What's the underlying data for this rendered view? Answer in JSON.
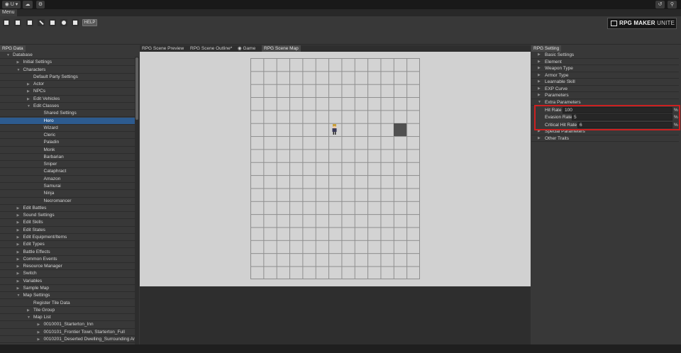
{
  "topbar": {
    "account_label": "U",
    "history_icon": "history-icon",
    "search_icon": "search-icon"
  },
  "menubar": {
    "menu_label": "Menu"
  },
  "toolbar": {
    "help_label": "HELP",
    "logo_text": "RPG MAKER",
    "logo_suffix": "UNITE"
  },
  "left_panel": {
    "tab": "RPG Data",
    "tree": [
      {
        "label": "Database",
        "indent": 0,
        "arrow": "down"
      },
      {
        "label": "Initial Settings",
        "indent": 1,
        "arrow": "right"
      },
      {
        "label": "Characters",
        "indent": 1,
        "arrow": "down"
      },
      {
        "label": "Default Party Settings",
        "indent": 2,
        "arrow": ""
      },
      {
        "label": "Actor",
        "indent": 2,
        "arrow": "right"
      },
      {
        "label": "NPCs",
        "indent": 2,
        "arrow": "right"
      },
      {
        "label": "Edit Vehicles",
        "indent": 2,
        "arrow": "right"
      },
      {
        "label": "Edit Classes",
        "indent": 2,
        "arrow": "down"
      },
      {
        "label": "Shared Settings",
        "indent": 3,
        "arrow": ""
      },
      {
        "label": "Hero",
        "indent": 3,
        "arrow": "",
        "selected": true
      },
      {
        "label": "Wizard",
        "indent": 3,
        "arrow": ""
      },
      {
        "label": "Cleric",
        "indent": 3,
        "arrow": ""
      },
      {
        "label": "Paladin",
        "indent": 3,
        "arrow": ""
      },
      {
        "label": "Monk",
        "indent": 3,
        "arrow": ""
      },
      {
        "label": "Barbarian",
        "indent": 3,
        "arrow": ""
      },
      {
        "label": "Sniper",
        "indent": 3,
        "arrow": ""
      },
      {
        "label": "Cataphract",
        "indent": 3,
        "arrow": ""
      },
      {
        "label": "Amazon",
        "indent": 3,
        "arrow": ""
      },
      {
        "label": "Samurai",
        "indent": 3,
        "arrow": ""
      },
      {
        "label": "Ninja",
        "indent": 3,
        "arrow": ""
      },
      {
        "label": "Necromancer",
        "indent": 3,
        "arrow": ""
      },
      {
        "label": "Edit Battles",
        "indent": 1,
        "arrow": "right"
      },
      {
        "label": "Sound Settings",
        "indent": 1,
        "arrow": "right"
      },
      {
        "label": "Edit Skills",
        "indent": 1,
        "arrow": "right"
      },
      {
        "label": "Edit States",
        "indent": 1,
        "arrow": "right"
      },
      {
        "label": "Edit Equipment/Items",
        "indent": 1,
        "arrow": "right"
      },
      {
        "label": "Edit Types",
        "indent": 1,
        "arrow": "right"
      },
      {
        "label": "Battle Effects",
        "indent": 1,
        "arrow": "right"
      },
      {
        "label": "Common Events",
        "indent": 1,
        "arrow": "right"
      },
      {
        "label": "Resource Manager",
        "indent": 1,
        "arrow": "right"
      },
      {
        "label": "Switch",
        "indent": 1,
        "arrow": "right"
      },
      {
        "label": "Variables",
        "indent": 1,
        "arrow": "right"
      },
      {
        "label": "Sample Map",
        "indent": 1,
        "arrow": "right"
      },
      {
        "label": "Map Settings",
        "indent": 1,
        "arrow": "down"
      },
      {
        "label": "Register Tile Data",
        "indent": 2,
        "arrow": ""
      },
      {
        "label": "Tile Group",
        "indent": 2,
        "arrow": "right"
      },
      {
        "label": "Map List",
        "indent": 2,
        "arrow": "down"
      },
      {
        "label": "0010001_Starterton_Inn",
        "indent": 3,
        "arrow": "right"
      },
      {
        "label": "0010101_Frontier Town, Starterton_Full",
        "indent": 3,
        "arrow": "right"
      },
      {
        "label": "0010201_Deserted Dwelling_Surrounding Area",
        "indent": 3,
        "arrow": "right"
      }
    ]
  },
  "center": {
    "tabs": [
      {
        "label": "RPG Scene Preview",
        "active": false
      },
      {
        "label": "RPG Scene Outline*",
        "active": false
      },
      {
        "label": "Game",
        "active": false,
        "icon": "gamepad-icon"
      },
      {
        "label": "RPG Scene Map",
        "active": true
      }
    ]
  },
  "right_panel": {
    "tab": "RPG Setting",
    "items": [
      {
        "label": "Basic Settings",
        "arrow": "right"
      },
      {
        "label": "Element",
        "arrow": "right"
      },
      {
        "label": "Weapon Type",
        "arrow": "right"
      },
      {
        "label": "Armor Type",
        "arrow": "right"
      },
      {
        "label": "Learnable Skill",
        "arrow": "right"
      },
      {
        "label": "EXP Curve",
        "arrow": "right"
      },
      {
        "label": "Parameters",
        "arrow": "right"
      },
      {
        "label": "Extra Parameters",
        "arrow": "down"
      }
    ],
    "extra_parameters": [
      {
        "label": "Hit Rate",
        "value": "100",
        "unit": "%"
      },
      {
        "label": "Evasion Rate",
        "value": "5",
        "unit": "%"
      },
      {
        "label": "Critical Hit Rate",
        "value": "6",
        "unit": "%"
      }
    ],
    "items_after": [
      {
        "label": "Special Parameters",
        "arrow": "right"
      },
      {
        "label": "Other Traits",
        "arrow": "right"
      }
    ]
  },
  "colors": {
    "selection": "#2d5b8f",
    "highlight_border": "#cc2020",
    "map_background": "#d1d1d1"
  }
}
